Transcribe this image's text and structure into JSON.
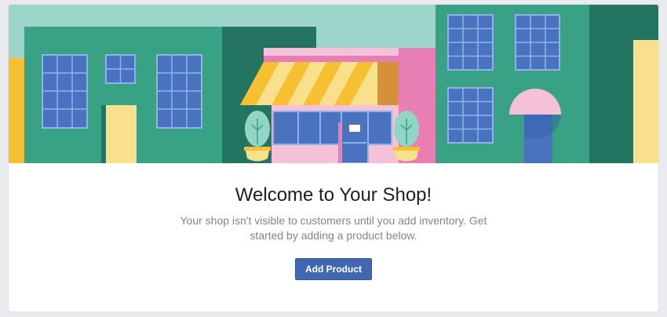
{
  "shop_welcome": {
    "title": "Welcome to Your Shop!",
    "description": "Your shop isn't visible to customers until you add inventory. Get started by adding a product below.",
    "add_product_label": "Add Product"
  },
  "colors": {
    "accent_button": "#4267b2",
    "sky": "#9dd5cb",
    "building_green": "#39a184",
    "building_dark_green": "#237561",
    "window_blue": "#4a73bf",
    "shop_pink": "#f4c1d8",
    "awning_yellow": "#f5c031"
  }
}
